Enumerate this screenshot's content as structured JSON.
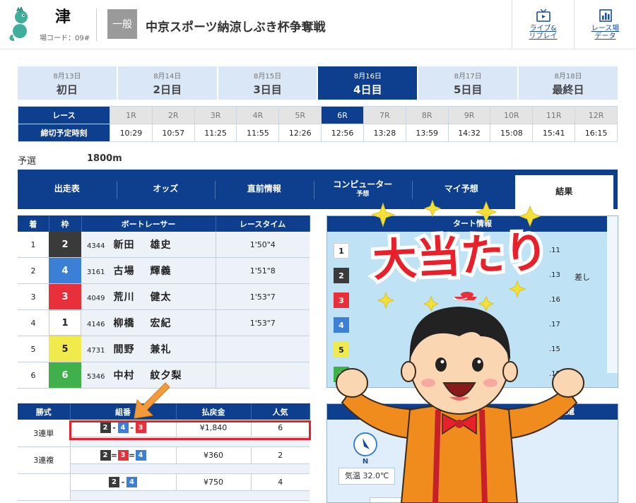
{
  "header": {
    "venue": "津",
    "venue_code": "場コード：09#",
    "grade": "一般",
    "race_title": "中京スポーツ納涼しぶき杯争奪戦",
    "links": [
      {
        "line1": "ライブ&",
        "line2": "リプレイ",
        "icon": "tv-icon"
      },
      {
        "line1": "レース場",
        "line2": "データ",
        "icon": "chart-icon"
      }
    ]
  },
  "days": [
    {
      "date": "8月13日",
      "label": "初日"
    },
    {
      "date": "8月14日",
      "label": "2日目"
    },
    {
      "date": "8月15日",
      "label": "3日目"
    },
    {
      "date": "8月16日",
      "label": "4日目",
      "active": true
    },
    {
      "date": "8月17日",
      "label": "5日目"
    },
    {
      "date": "8月18日",
      "label": "最終日"
    }
  ],
  "schedule": {
    "race_label": "レース",
    "time_label": "締切予定時刻",
    "races": [
      "1R",
      "2R",
      "3R",
      "4R",
      "5R",
      "6R",
      "7R",
      "8R",
      "9R",
      "10R",
      "11R",
      "12R"
    ],
    "active_race": "6R",
    "times": [
      "10:29",
      "10:57",
      "11:25",
      "11:55",
      "12:26",
      "12:56",
      "13:28",
      "13:59",
      "14:32",
      "15:08",
      "15:41",
      "16:15"
    ]
  },
  "race_info": {
    "type": "予選",
    "distance": "1800m"
  },
  "tabs": [
    {
      "label": "出走表"
    },
    {
      "label": "オッズ"
    },
    {
      "label": "直前情報"
    },
    {
      "label": "コンピューター",
      "sub": "予想"
    },
    {
      "label": "マイ予想"
    },
    {
      "label": "結果",
      "active": true
    }
  ],
  "results": {
    "headers": [
      "着",
      "枠",
      "ボートレーサー",
      "レースタイム"
    ],
    "rows": [
      {
        "rank": "1",
        "frame": "2",
        "reg": "4344",
        "family": "新田",
        "given": "雄史",
        "time": "1'50\"4"
      },
      {
        "rank": "2",
        "frame": "4",
        "reg": "3161",
        "family": "古場",
        "given": "輝義",
        "time": "1'51\"8"
      },
      {
        "rank": "3",
        "frame": "3",
        "reg": "4049",
        "family": "荒川",
        "given": "健太",
        "time": "1'53\"7"
      },
      {
        "rank": "4",
        "frame": "1",
        "reg": "4146",
        "family": "柳橋",
        "given": "宏紀",
        "time": "1'53\"7"
      },
      {
        "rank": "5",
        "frame": "5",
        "reg": "4731",
        "family": "間野",
        "given": "兼礼",
        "time": ""
      },
      {
        "rank": "6",
        "frame": "6",
        "reg": "5346",
        "family": "中村",
        "given": "紋夕梨",
        "time": ""
      }
    ]
  },
  "start_info": {
    "title": "スタート情報",
    "title_visible": "タート情報",
    "rows": [
      {
        "frame": "1",
        "st": ".11",
        "note": ""
      },
      {
        "frame": "2",
        "st": ".13",
        "note": "差し"
      },
      {
        "frame": "3",
        "st": ".16",
        "note": ""
      },
      {
        "frame": "4",
        "st": ".17",
        "note": ""
      },
      {
        "frame": "5",
        "st": ".15",
        "note": ""
      },
      {
        "frame": "6",
        "st": ".15",
        "note": ""
      }
    ]
  },
  "payout": {
    "headers": [
      "勝式",
      "組番",
      "払戻金",
      "人気"
    ],
    "rows": [
      {
        "kind": "3連単",
        "combo": [
          "2",
          "4",
          "3"
        ],
        "sep": "-",
        "amount": "¥1,840",
        "pop": "6"
      },
      {
        "kind": "3連複",
        "combo": [
          "2",
          "3",
          "4"
        ],
        "sep": "=",
        "amount": "¥360",
        "pop": "2"
      },
      {
        "kind": "",
        "combo": [
          "2",
          "4"
        ],
        "sep": "-",
        "amount": "¥750",
        "pop": "4"
      }
    ]
  },
  "weather": {
    "header_left": "水面",
    "header_right": "波還",
    "air_temp": "気温 32.0℃",
    "compass_label": "N"
  },
  "overlay": {
    "text": "大当たり"
  },
  "colors": {
    "navy": "#0e3f8f",
    "highlight_red": "#e8202a",
    "frame1": "#ffffff",
    "frame2": "#3a3a3a",
    "frame3": "#e8303a",
    "frame4": "#3b7fd6",
    "frame5": "#f1ea4c",
    "frame6": "#3fb04a"
  }
}
